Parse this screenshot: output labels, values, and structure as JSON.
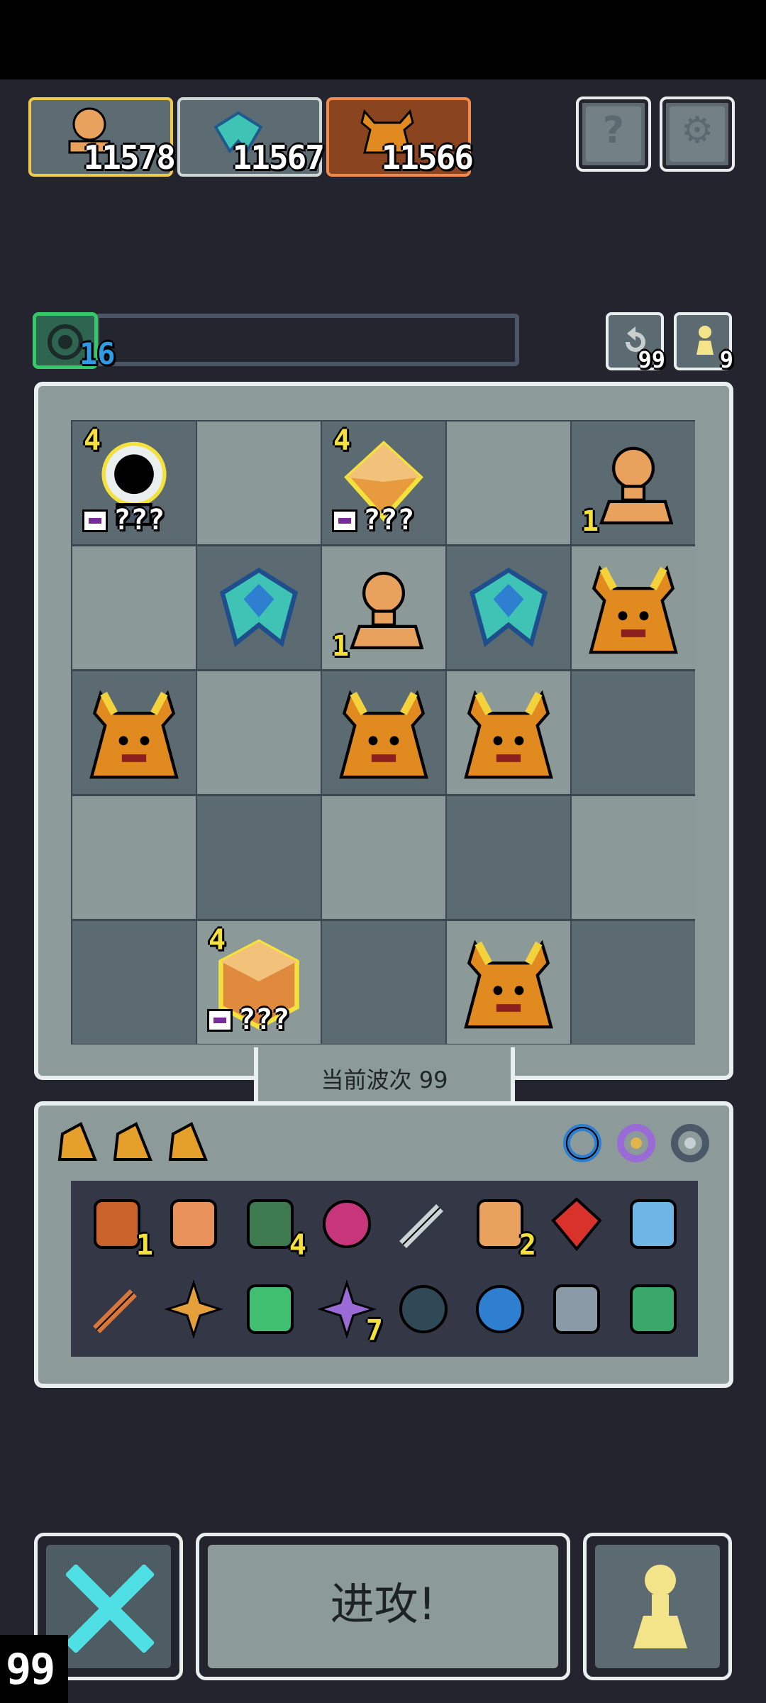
{
  "heroes": [
    {
      "name_icon": "peach-bust-icon",
      "score": "11578",
      "border": "#f2c94a"
    },
    {
      "name_icon": "teal-crystal-ship-icon",
      "score": "11567",
      "border": "#cfd6d6"
    },
    {
      "name_icon": "horned-beast-icon",
      "score": "11566",
      "border": "#ef8b4e"
    }
  ],
  "top_buttons": {
    "help_glyph": "?",
    "settings_glyph": "⚙"
  },
  "xp": {
    "value": "16"
  },
  "counters": {
    "refresh": "99",
    "pawn": "9"
  },
  "board": {
    "rows": [
      [
        {
          "u": "eye-cannon-icon",
          "lvl": "4",
          "label": "???"
        },
        {
          "u": ""
        },
        {
          "u": "amber-gem-icon",
          "lvl": "4",
          "label": "???"
        },
        {
          "u": ""
        },
        {
          "u": "peach-bust-icon",
          "lvl": "1"
        }
      ],
      [
        {
          "u": ""
        },
        {
          "u": "teal-crystal-ship-icon"
        },
        {
          "u": "peach-bust-icon",
          "lvl": "1"
        },
        {
          "u": "teal-crystal-ship-icon"
        },
        {
          "u": "horned-beast-icon"
        }
      ],
      [
        {
          "u": "horned-beast-icon"
        },
        {
          "u": ""
        },
        {
          "u": "horned-beast-icon"
        },
        {
          "u": "horned-beast-icon"
        },
        {
          "u": ""
        }
      ],
      [
        {
          "u": ""
        },
        {
          "u": ""
        },
        {
          "u": ""
        },
        {
          "u": ""
        },
        {
          "u": ""
        }
      ],
      [
        {
          "u": ""
        },
        {
          "u": "amber-cube-icon",
          "lvl": "4",
          "label": "???"
        },
        {
          "u": ""
        },
        {
          "u": "horned-beast-icon"
        },
        {
          "u": ""
        }
      ]
    ]
  },
  "wave_label": "当前波次 99",
  "shards": [
    "amber-shard-icon",
    "amber-shard-icon",
    "amber-shard-icon"
  ],
  "rings": [
    "blue-ring-icon",
    "purple-ring-icon",
    "gray-ring-icon"
  ],
  "items_row1": [
    {
      "icon": "barrel-icon",
      "count": "1"
    },
    {
      "icon": "tribal-mask-icon",
      "count": ""
    },
    {
      "icon": "green-hood-icon",
      "count": "4"
    },
    {
      "icon": "pink-orb-icon",
      "count": ""
    },
    {
      "icon": "syringe-icon",
      "count": ""
    },
    {
      "icon": "bust-statue-icon",
      "count": "2"
    },
    {
      "icon": "red-gem-icon",
      "count": ""
    },
    {
      "icon": "molecule-icon",
      "count": ""
    }
  ],
  "items_row2": [
    {
      "icon": "sword-icon",
      "count": ""
    },
    {
      "icon": "shards-spark-icon",
      "count": ""
    },
    {
      "icon": "recycle-jar-icon",
      "count": ""
    },
    {
      "icon": "purple-star-icon",
      "count": "7"
    },
    {
      "icon": "target-icon",
      "count": ""
    },
    {
      "icon": "blue-shield-icon",
      "count": ""
    },
    {
      "icon": "spiked-helm-icon",
      "count": ""
    },
    {
      "icon": "green-potion-icon",
      "count": ""
    }
  ],
  "buttons": {
    "attack_label": "进攻!"
  },
  "corner_counter": "99",
  "colors": {
    "bg": "#23242d",
    "board": "#8c9a99",
    "cell_dark": "#5c6b72",
    "accent_yellow": "#f4e13b",
    "accent_blue": "#2f9be6"
  }
}
